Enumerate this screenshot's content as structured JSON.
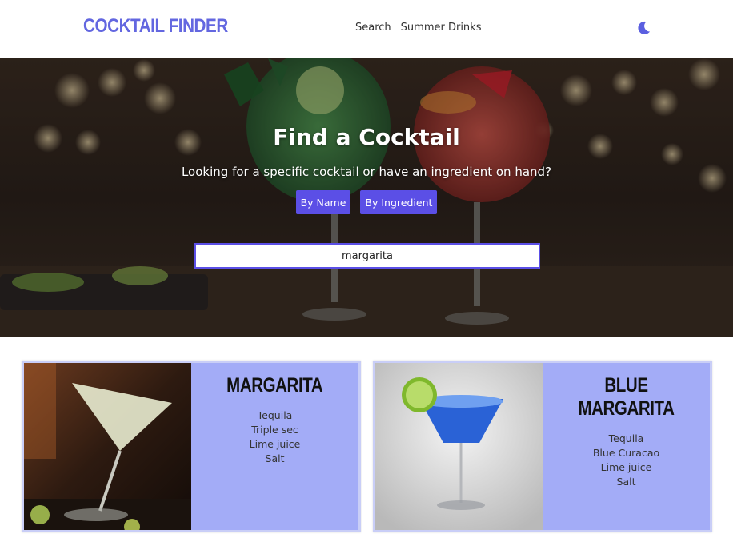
{
  "header": {
    "logo": "COCKTAIL FINDER",
    "nav": [
      "Search",
      "Summer Drinks"
    ],
    "theme_icon": "moon-icon"
  },
  "hero": {
    "title": "Find a Cocktail",
    "subtitle": "Looking for a specific cocktail or have an ingredient on hand?",
    "buttons": [
      "By Name",
      "By Ingredient"
    ],
    "search_value": "margarita"
  },
  "results": [
    {
      "name": "MARGARITA",
      "ingredients": [
        "Tequila",
        "Triple sec",
        "Lime juice",
        "Salt"
      ]
    },
    {
      "name": "BLUE MARGARITA",
      "ingredients": [
        "Tequila",
        "Blue Curacao",
        "Lime juice",
        "Salt"
      ]
    }
  ],
  "colors": {
    "accent": "#5b4fe6",
    "logo": "#6367e0",
    "card_bg": "#a3acf7",
    "card_border": "#c9cef7"
  }
}
